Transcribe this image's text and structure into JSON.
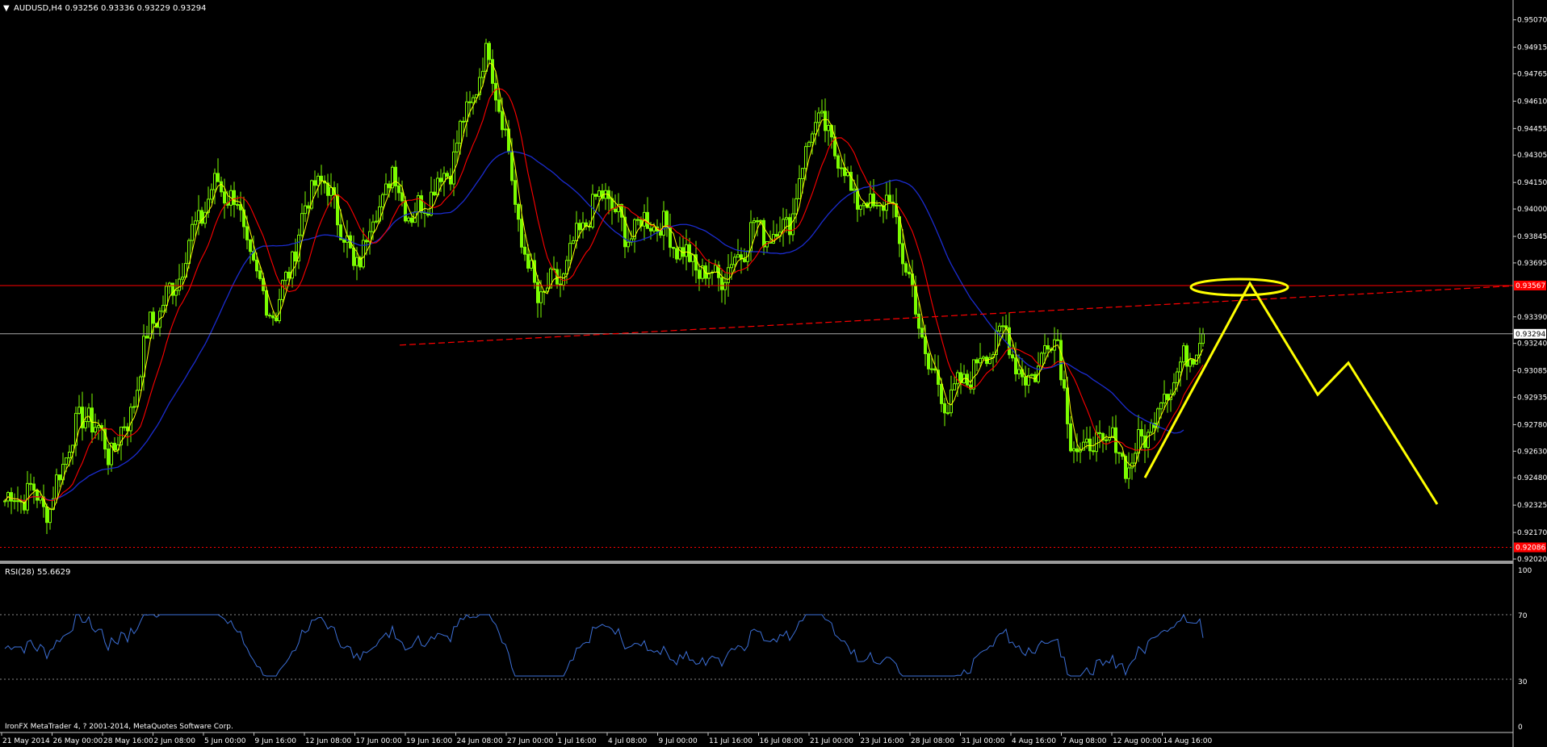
{
  "main_window": {
    "header": "AUDUSD,H4  0.93256 0.93336 0.93229 0.93294",
    "current_price": "0.93294",
    "line_price_label": "0.93567",
    "support_price_label": "0.92086",
    "copyright": "IronFX MetaTrader 4, ? 2001-2014, MetaQuotes Software Corp."
  },
  "rsi_window": {
    "header": "RSI(28) 55.6629",
    "levels": [
      "100",
      "70",
      "30",
      "0"
    ]
  },
  "colors": {
    "background": "#000000",
    "candles": "#7cfc00",
    "fast_ma": "#ffff00",
    "medium_ma": "#ff0000",
    "slow_ma": "#1b2ccf",
    "rsi_line": "#3c6fd6",
    "resistance_line": "#ff0000",
    "projection": "#ffff00",
    "separator": "#9a9a9a"
  },
  "chart_data": {
    "type": "candlestick",
    "symbol": "AUDUSD",
    "timeframe": "H4",
    "ohlc_current": {
      "open": 0.93256,
      "high": 0.93336,
      "low": 0.93229,
      "close": 0.93294
    },
    "y_range": [
      0.9202,
      0.951
    ],
    "y_ticks": [
      "0.95070",
      "0.94915",
      "0.94765",
      "0.94610",
      "0.94455",
      "0.94305",
      "0.94150",
      "0.94000",
      "0.93845",
      "0.93695",
      "0.93390",
      "0.93240",
      "0.93085",
      "0.92935",
      "0.92780",
      "0.92630",
      "0.92480",
      "0.92325",
      "0.92170",
      "0.92020"
    ],
    "x_labels": [
      "21 May 2014",
      "26 May 00:00",
      "28 May 16:00",
      "2 Jun 08:00",
      "5 Jun 00:00",
      "9 Jun 16:00",
      "12 Jun 08:00",
      "17 Jun 00:00",
      "19 Jun 16:00",
      "24 Jun 08:00",
      "27 Jun 00:00",
      "1 Jul 16:00",
      "4 Jul 08:00",
      "9 Jul 00:00",
      "11 Jul 16:00",
      "16 Jul 08:00",
      "21 Jul 00:00",
      "23 Jul 16:00",
      "28 Jul 08:00",
      "31 Jul 00:00",
      "4 Aug 16:00",
      "7 Aug 08:00",
      "12 Aug 00:00",
      "14 Aug 16:00"
    ],
    "price_keypoints": [
      [
        0,
        0.9235
      ],
      [
        8,
        0.924
      ],
      [
        14,
        0.923
      ],
      [
        20,
        0.927
      ],
      [
        26,
        0.9285
      ],
      [
        32,
        0.9262
      ],
      [
        38,
        0.9278
      ],
      [
        45,
        0.9335
      ],
      [
        52,
        0.9355
      ],
      [
        60,
        0.9395
      ],
      [
        66,
        0.9415
      ],
      [
        72,
        0.9402
      ],
      [
        78,
        0.9358
      ],
      [
        84,
        0.934
      ],
      [
        90,
        0.938
      ],
      [
        96,
        0.9418
      ],
      [
        102,
        0.9405
      ],
      [
        108,
        0.9365
      ],
      [
        114,
        0.9395
      ],
      [
        120,
        0.942
      ],
      [
        126,
        0.9395
      ],
      [
        132,
        0.941
      ],
      [
        138,
        0.9425
      ],
      [
        144,
        0.946
      ],
      [
        150,
        0.949
      ],
      [
        156,
        0.943
      ],
      [
        160,
        0.938
      ],
      [
        165,
        0.935
      ],
      [
        172,
        0.936
      ],
      [
        180,
        0.9395
      ],
      [
        186,
        0.941
      ],
      [
        192,
        0.9385
      ],
      [
        200,
        0.9395
      ],
      [
        206,
        0.9385
      ],
      [
        212,
        0.937
      ],
      [
        218,
        0.9362
      ],
      [
        224,
        0.9365
      ],
      [
        232,
        0.939
      ],
      [
        238,
        0.9385
      ],
      [
        244,
        0.9398
      ],
      [
        250,
        0.945
      ],
      [
        256,
        0.944
      ],
      [
        262,
        0.941
      ],
      [
        268,
        0.94
      ],
      [
        274,
        0.9405
      ],
      [
        280,
        0.936
      ],
      [
        286,
        0.931
      ],
      [
        292,
        0.929
      ],
      [
        298,
        0.9305
      ],
      [
        304,
        0.932
      ],
      [
        310,
        0.933
      ],
      [
        316,
        0.93
      ],
      [
        322,
        0.932
      ],
      [
        326,
        0.933
      ],
      [
        330,
        0.9265
      ],
      [
        336,
        0.9265
      ],
      [
        342,
        0.927
      ],
      [
        348,
        0.9255
      ],
      [
        354,
        0.9275
      ],
      [
        360,
        0.93
      ],
      [
        366,
        0.9315
      ],
      [
        370,
        0.9329
      ]
    ],
    "support_level": 0.92086,
    "resistance_level": 0.93567,
    "projection_path": [
      [
        "12 Aug 08:00",
        0.9248
      ],
      [
        "",
        0.9358
      ],
      [
        "",
        0.9295
      ],
      [
        "",
        0.9313
      ],
      [
        "",
        0.9233
      ]
    ],
    "rsi_period": 28,
    "rsi_current": 55.6629,
    "rsi_range": [
      0,
      100
    ],
    "rsi_levels": [
      70,
      30
    ]
  }
}
